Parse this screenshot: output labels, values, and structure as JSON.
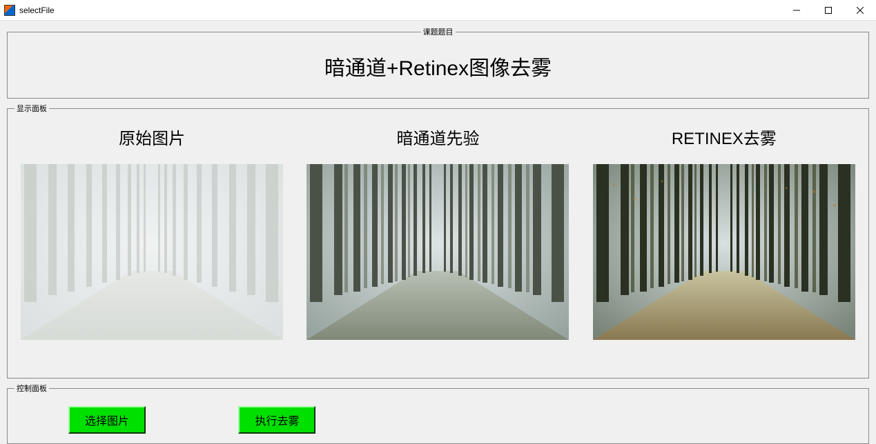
{
  "window": {
    "title": "selectFile"
  },
  "panels": {
    "title_legend": "课题题目",
    "display_legend": "显示面板",
    "control_legend": "控制面板"
  },
  "main_title": "暗通道+Retinex图像去雾",
  "images": {
    "original_label": "原始图片",
    "dark_channel_label": "暗通道先验",
    "retinex_label": "RETINEX去雾"
  },
  "buttons": {
    "select_image": "选择图片",
    "execute_dehaze": "执行去雾"
  }
}
